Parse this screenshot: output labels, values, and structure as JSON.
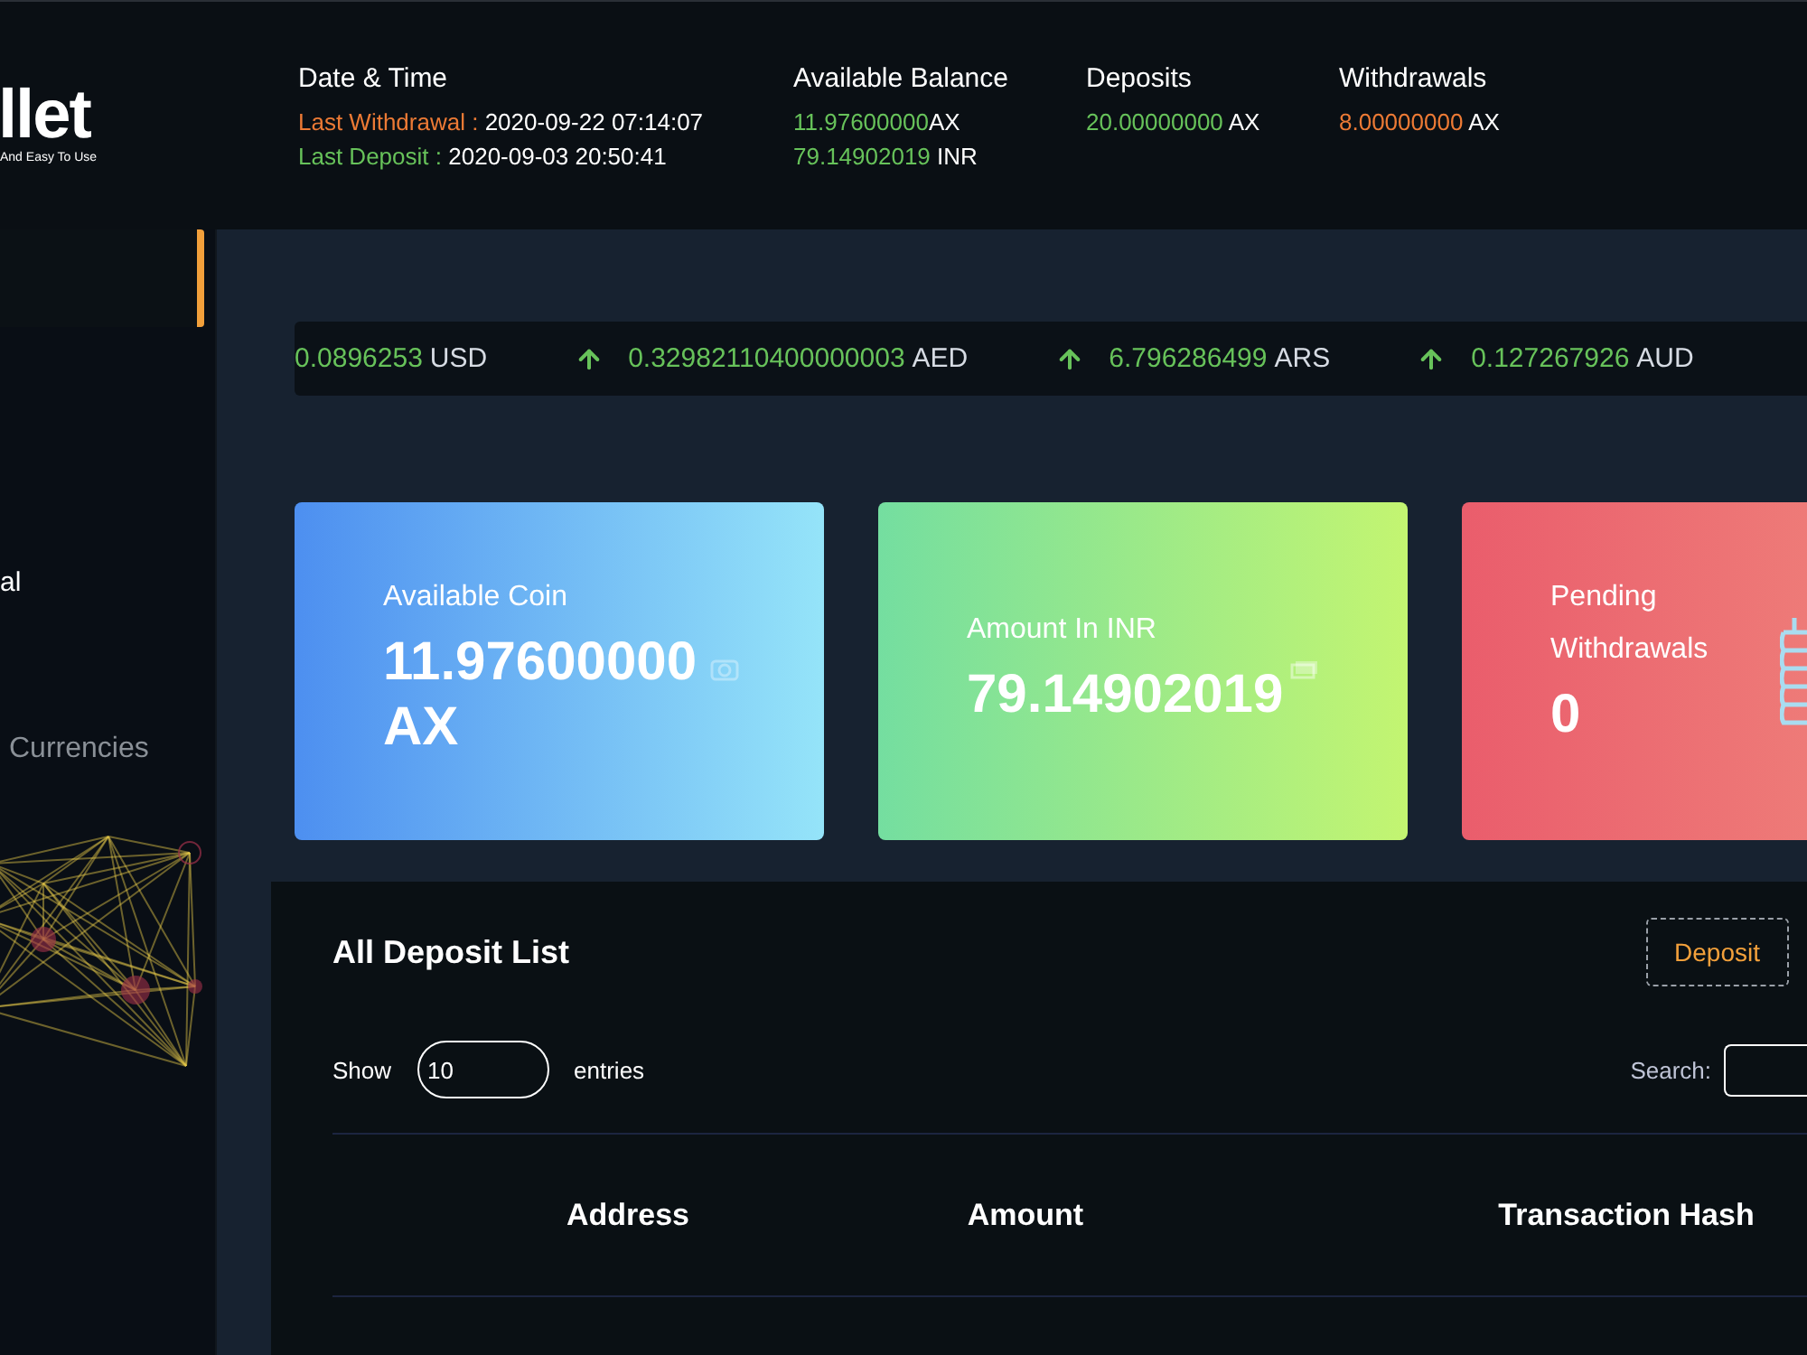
{
  "logo": {
    "name": "llet",
    "tagline": "And Easy To Use"
  },
  "header": {
    "date_time": {
      "title": "Date & Time",
      "rows": [
        {
          "label": "Last Withdrawal :",
          "value": "2020-09-22 07:14:07",
          "kind": "withdrawal"
        },
        {
          "label": "Last Deposit :",
          "value": "2020-09-03 20:50:41",
          "kind": "deposit"
        }
      ]
    },
    "balance": {
      "title": "Available Balance",
      "rows": [
        {
          "amount": "11.97600000",
          "unit": "AX"
        },
        {
          "amount": "79.14902019",
          "unit": "INR"
        }
      ]
    },
    "deposits": {
      "title": "Deposits",
      "amount": "20.00000000",
      "unit": "AX"
    },
    "withdrawals": {
      "title": "Withdrawals",
      "amount": "8.00000000",
      "unit": "AX"
    }
  },
  "sidebar": {
    "items": [
      {
        "selected": true
      },
      {
        "label": "al",
        "selected": false
      }
    ],
    "section_label": "Currencies"
  },
  "ticker": [
    {
      "value": "0.0896253",
      "currency": "USD",
      "arrow": false
    },
    {
      "value": "0.32982110400000003",
      "currency": "AED",
      "arrow": true
    },
    {
      "value": "6.796286499",
      "currency": "ARS",
      "arrow": true
    },
    {
      "value": "0.127267926",
      "currency": "AUD",
      "arrow": true
    }
  ],
  "cards": [
    {
      "kind": "coin",
      "label": "Available Coin",
      "value": "11.97600000 AX"
    },
    {
      "kind": "cash",
      "label": "Amount In INR",
      "value": "79.14902019"
    },
    {
      "kind": "pending",
      "label": "Pending Withdrawals",
      "value": "0"
    }
  ],
  "deposit_list": {
    "title": "All Deposit List",
    "button": "Deposit",
    "show_label": "Show",
    "entries_value": "10",
    "entries_label": "entries",
    "search_label": "Search:",
    "columns": [
      "Address",
      "Amount",
      "Transaction Hash"
    ]
  }
}
